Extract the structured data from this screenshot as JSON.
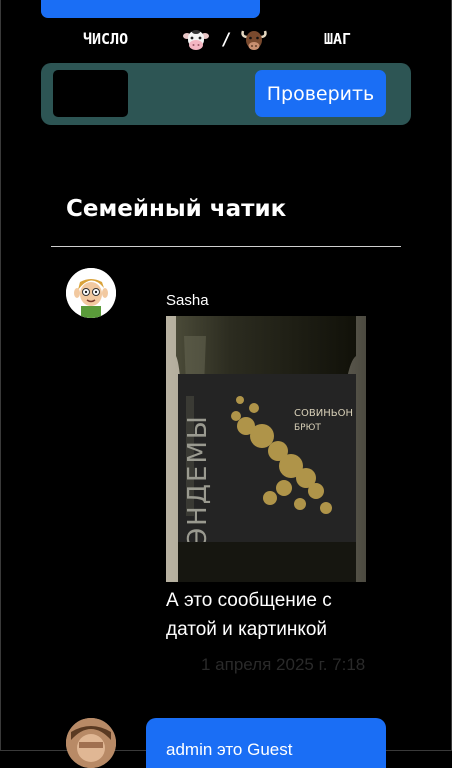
{
  "game": {
    "top_button_label": "",
    "label_number": "ЧИСЛО",
    "label_step": "ШАГ",
    "separator": "/",
    "input_value": "",
    "check_button": "Проверить",
    "cow_icon": "cow-face-icon",
    "bull_icon": "bull-head-icon"
  },
  "chat": {
    "title": "Семейный чатик",
    "messages": [
      {
        "sender": "Sasha",
        "image": "wine-bottle-photo",
        "text": "А это сообщение с датой и картинкой",
        "time": "1 апреля 2025 г. 7:18"
      },
      {
        "text": "admin это Guest"
      }
    ]
  },
  "colors": {
    "background": "#000000",
    "accent": "#1a6ef5",
    "game_bar": "#2d5554"
  }
}
